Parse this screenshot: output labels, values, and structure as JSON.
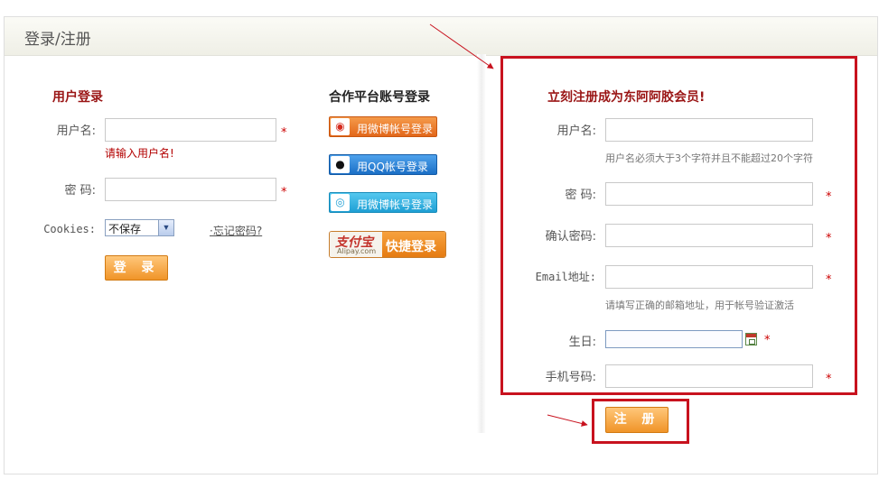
{
  "page": {
    "title": "登录/注册"
  },
  "login": {
    "title": "用户登录",
    "username_label": "用户名:",
    "username_value": "",
    "username_error": "请输入用户名!",
    "password_label": "密 码:",
    "password_value": "",
    "cookies_label": "Cookies:",
    "cookies_selected": "不保存",
    "forgot_label": "·忘记密码?",
    "submit_label": "登 录",
    "required_mark": "*"
  },
  "partner": {
    "title": "合作平台账号登录",
    "buttons": [
      {
        "label": "用微博帐号登录",
        "icon": "weibo-icon"
      },
      {
        "label": "用QQ帐号登录",
        "icon": "qq-icon"
      },
      {
        "label": "用微博帐号登录",
        "icon": "tencent-weibo-icon"
      }
    ],
    "alipay": {
      "brand": "支付宝",
      "brand_sub": "Alipay.com",
      "label": "快捷登录"
    }
  },
  "register": {
    "title": "立刻注册成为东阿阿胶会员!",
    "username_label": "用户名:",
    "username_hint": "用户名必须大于3个字符并且不能超过20个字符",
    "password_label": "密 码:",
    "confirm_label": "确认密码:",
    "email_label": "Email地址:",
    "email_hint": "请填写正确的邮箱地址，用于帐号验证激活",
    "birthday_label": "生日:",
    "phone_label": "手机号码:",
    "submit_label": "注 册",
    "required_mark": "*"
  },
  "colors": {
    "annotation_red": "#c8121e",
    "title_red": "#9a1515",
    "button_orange": "#f09428"
  }
}
